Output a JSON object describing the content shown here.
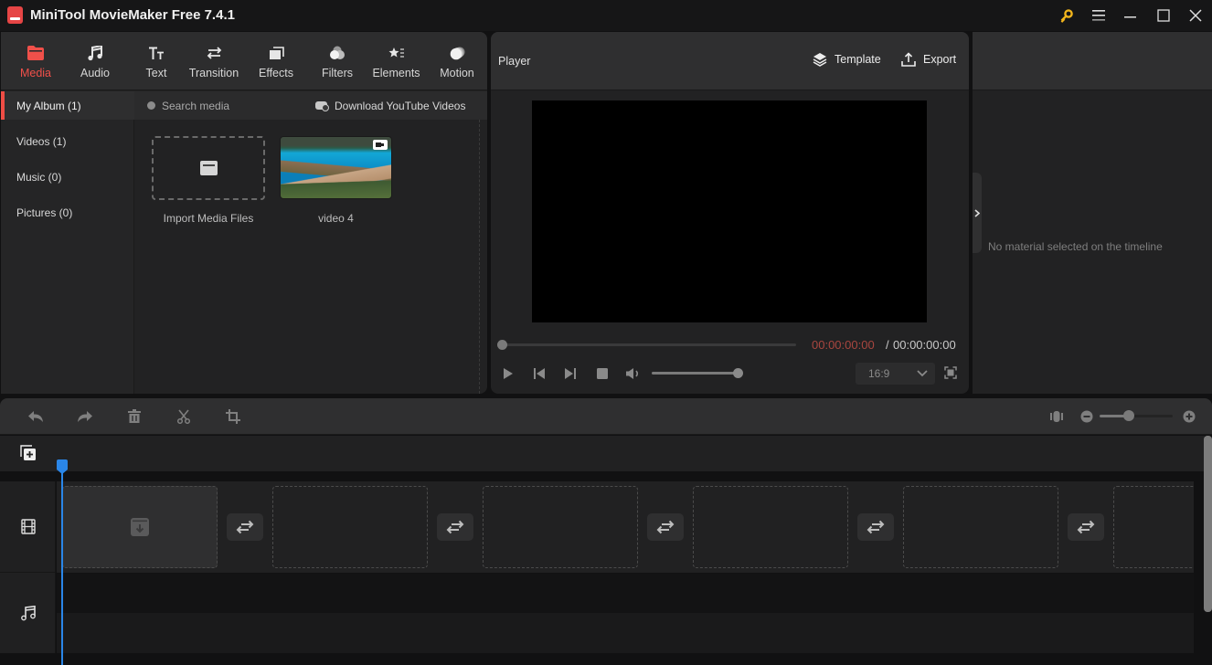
{
  "window": {
    "title": "MiniTool MovieMaker Free 7.4.1",
    "controls": [
      "key-icon",
      "menu-icon",
      "minimize-icon",
      "maximize-icon",
      "close-icon"
    ]
  },
  "toolbar": {
    "tabs": [
      {
        "label": "Media",
        "icon": "folder-icon",
        "active": true
      },
      {
        "label": "Audio",
        "icon": "music-note-icon"
      },
      {
        "label": "Text",
        "icon": "text-icon"
      },
      {
        "label": "Transition",
        "icon": "swap-arrows-icon"
      },
      {
        "label": "Effects",
        "icon": "effects-icon"
      },
      {
        "label": "Filters",
        "icon": "filters-icon"
      },
      {
        "label": "Elements",
        "icon": "elements-icon"
      },
      {
        "label": "Motion",
        "icon": "motion-icon"
      }
    ]
  },
  "album": {
    "items": [
      {
        "label": "My Album (1)",
        "active": true
      },
      {
        "label": "Videos (1)"
      },
      {
        "label": "Music (0)"
      },
      {
        "label": "Pictures (0)"
      }
    ]
  },
  "media": {
    "search_placeholder": "Search media",
    "download_label": "Download YouTube Videos",
    "import_label": "Import Media Files",
    "files": [
      {
        "name": "video 4",
        "type": "video"
      }
    ]
  },
  "player": {
    "title": "Player",
    "template_label": "Template",
    "export_label": "Export",
    "time_current": "00:00:00:00",
    "time_separator": "/",
    "time_total": "00:00:00:00",
    "progress": 0,
    "volume": 1.0,
    "aspect_ratio": "16:9",
    "accent_color": "#a8463f"
  },
  "properties": {
    "empty_message": "No material selected on the timeline"
  },
  "timeline": {
    "tools": [
      "undo",
      "redo",
      "delete",
      "split",
      "crop"
    ],
    "zoom_level": 0.4,
    "playhead_color": "#2a86e8",
    "slots": 6
  }
}
